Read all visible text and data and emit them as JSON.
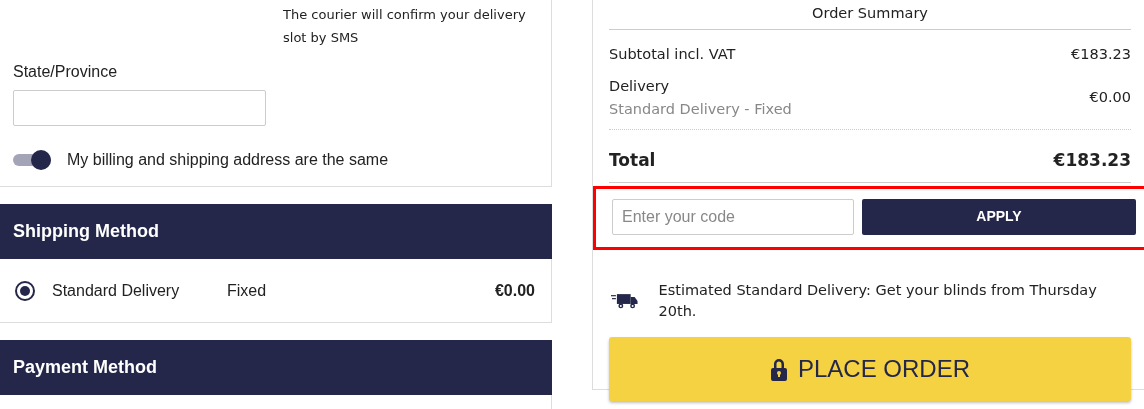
{
  "address": {
    "courier_note": "The courier will confirm your delivery slot by SMS",
    "state_label": "State/Province",
    "same_address_toggle": {
      "label": "My billing and shipping address are the same",
      "on": true
    }
  },
  "shipping_method": {
    "title": "Shipping Method",
    "options": [
      {
        "name": "Standard Delivery",
        "type": "Fixed",
        "price": "€0.00",
        "selected": true
      }
    ]
  },
  "payment_method": {
    "title": "Payment Method"
  },
  "order_summary": {
    "title": "Order Summary",
    "subtotal": {
      "label": "Subtotal incl. VAT",
      "value": "€183.23"
    },
    "delivery": {
      "label": "Delivery",
      "detail": "Standard Delivery - Fixed",
      "value": "€0.00"
    },
    "total": {
      "label": "Total",
      "value": "€183.23"
    },
    "coupon": {
      "placeholder": "Enter your code",
      "button": "APPLY",
      "highlighted": true
    },
    "delivery_estimate": "Estimated Standard Delivery: Get your blinds from Thursday 20th.",
    "place_order": "PLACE ORDER"
  }
}
